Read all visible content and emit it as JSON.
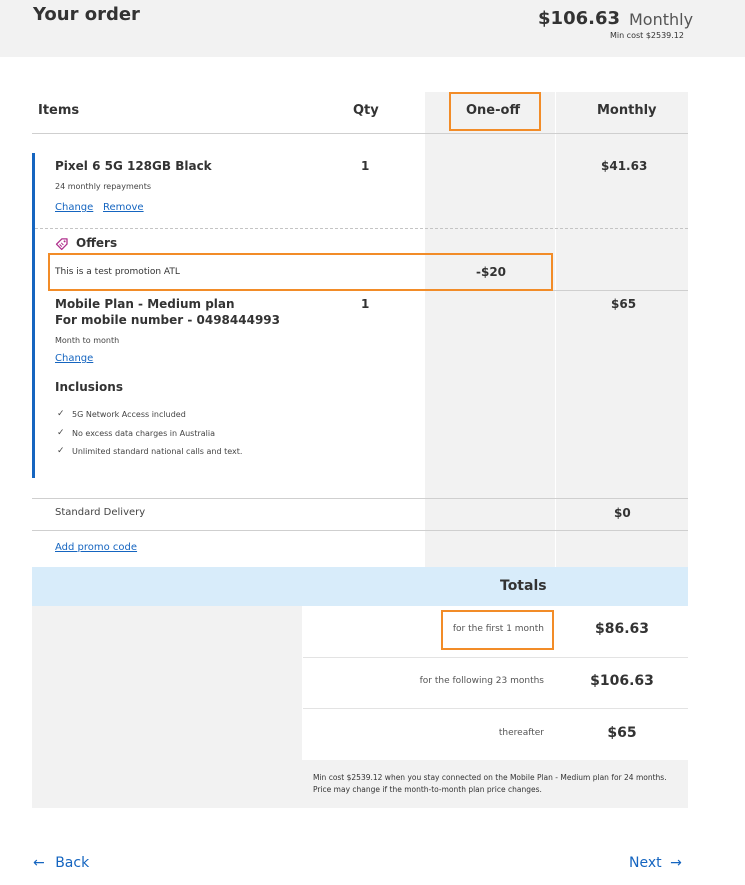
{
  "header": {
    "title": "Your order",
    "amount": "$106.63",
    "period": "Monthly",
    "min_cost": "Min cost $2539.12"
  },
  "table": {
    "col_items": "Items",
    "col_qty": "Qty",
    "col_oneoff": "One-off",
    "col_monthly": "Monthly"
  },
  "device": {
    "name": "Pixel 6 5G 128GB Black",
    "qty": "1",
    "subtitle": "24 monthly repayments",
    "monthly": "$41.63",
    "change_label": "Change",
    "remove_label": "Remove"
  },
  "offers": {
    "title": "Offers",
    "promotion_text": "This is a test promotion ATL",
    "promotion_value": "-$20"
  },
  "plan": {
    "name_line1": "Mobile Plan - Medium plan",
    "name_line2": "For mobile number - 0498444993",
    "qty": "1",
    "monthly": "$65",
    "subtitle": "Month to month",
    "change_label": "Change",
    "inclusions_title": "Inclusions",
    "inclusions": [
      "5G Network Access included",
      "No excess data charges in Australia",
      "Unlimited standard national calls and text."
    ]
  },
  "delivery": {
    "label": "Standard Delivery",
    "monthly": "$0"
  },
  "promo": {
    "link_label": "Add promo code"
  },
  "totals": {
    "title": "Totals",
    "rows": [
      {
        "label": "for the first 1 month",
        "value": "$86.63"
      },
      {
        "label": "for the following 23 months",
        "value": "$106.63"
      },
      {
        "label": "thereafter",
        "value": "$65"
      }
    ],
    "footnote": "Min cost $2539.12 when you stay connected on the Mobile Plan - Medium plan for 24 months. Price may change if the month-to-month plan price changes."
  },
  "nav": {
    "back_label": "Back",
    "next_label": "Next"
  },
  "colors": {
    "accent": "#1565c0",
    "highlight": "#f28c28",
    "totals_band": "#d8ecfa",
    "grey_column": "#f2f2f2"
  },
  "icons": {
    "offer_tag": "tag-icon",
    "check": "check-icon",
    "back": "arrow-left-icon",
    "next": "arrow-right-icon"
  }
}
